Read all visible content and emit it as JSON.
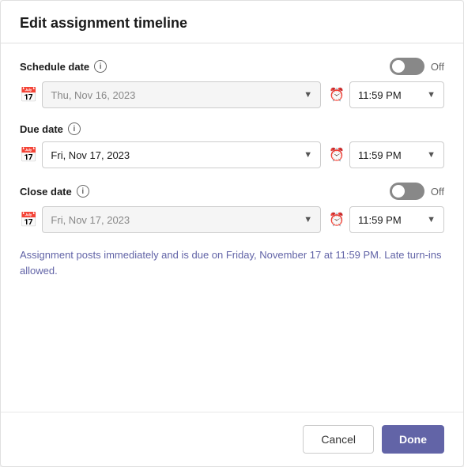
{
  "dialog": {
    "title": "Edit assignment timeline",
    "schedule_date": {
      "label": "Schedule date",
      "toggle_state": "off",
      "toggle_label": "Off",
      "date_value": "Thu, Nov 16, 2023",
      "date_placeholder": "Thu, Nov 16, 2023",
      "disabled": true,
      "time_value": "11:59 PM"
    },
    "due_date": {
      "label": "Due date",
      "date_value": "Fri, Nov 17, 2023",
      "disabled": false,
      "time_value": "11:59 PM"
    },
    "close_date": {
      "label": "Close date",
      "toggle_state": "off",
      "toggle_label": "Off",
      "date_value": "Fri, Nov 17, 2023",
      "date_placeholder": "Fri, Nov 17, 2023",
      "disabled": true,
      "time_value": "11:59 PM"
    },
    "info_text": "Assignment posts immediately and is due on Friday, November 17 at 11:59 PM. Late turn-ins allowed.",
    "cancel_label": "Cancel",
    "done_label": "Done"
  }
}
